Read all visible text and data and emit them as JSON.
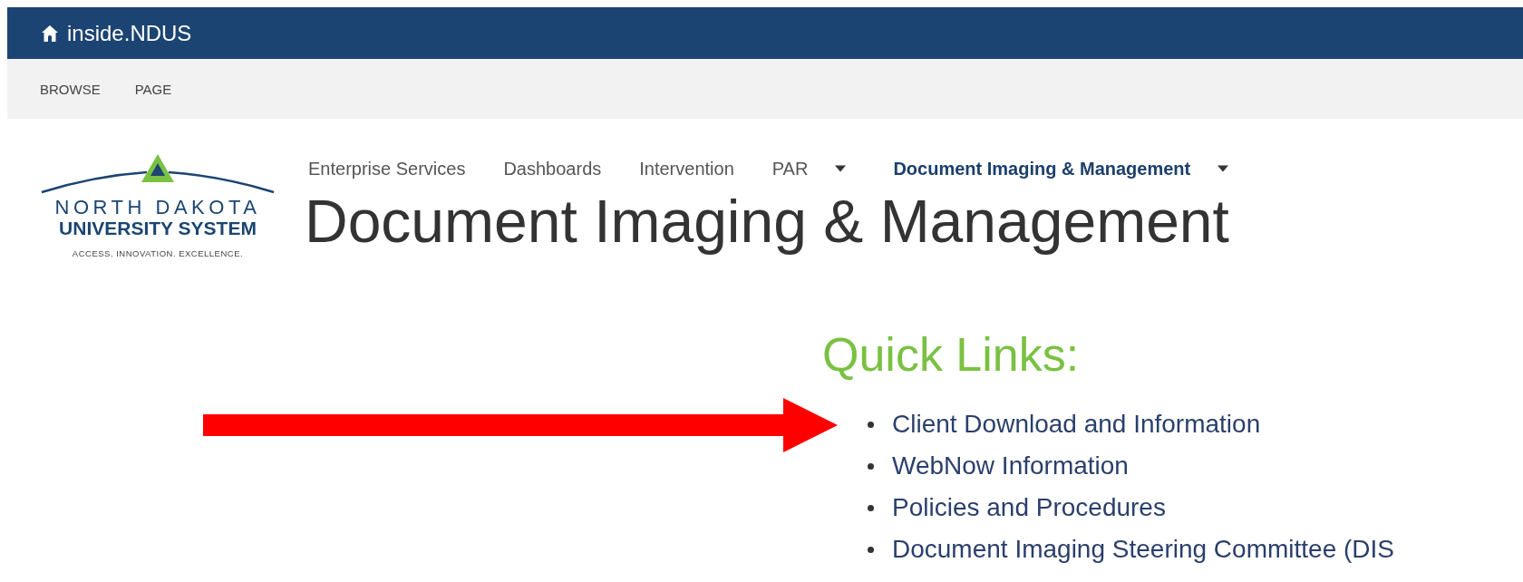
{
  "suite_bar": {
    "title": "inside.NDUS"
  },
  "ribbon_tabs": [
    {
      "label": "BROWSE"
    },
    {
      "label": "PAGE"
    }
  ],
  "logo": {
    "line_1": "NORTH DAKOTA",
    "line_2": "UNIVERSITY SYSTEM",
    "tagline": "ACCESS. INNOVATION. EXCELLENCE."
  },
  "top_nav": [
    {
      "label": "Enterprise Services",
      "selected": false,
      "has_menu": false
    },
    {
      "label": "Dashboards",
      "selected": false,
      "has_menu": false
    },
    {
      "label": "Intervention",
      "selected": false,
      "has_menu": false
    },
    {
      "label": "PAR",
      "selected": false,
      "has_menu": true
    },
    {
      "label": "Document Imaging & Management",
      "selected": true,
      "has_menu": true
    }
  ],
  "page_title": "Document Imaging & Management",
  "quick_links": {
    "heading": "Quick Links:",
    "items": [
      "Client Download and Information",
      "WebNow Information",
      "Policies and Procedures",
      "Document Imaging Steering Committee (DIS"
    ]
  },
  "annotation": {
    "kind": "arrow"
  }
}
